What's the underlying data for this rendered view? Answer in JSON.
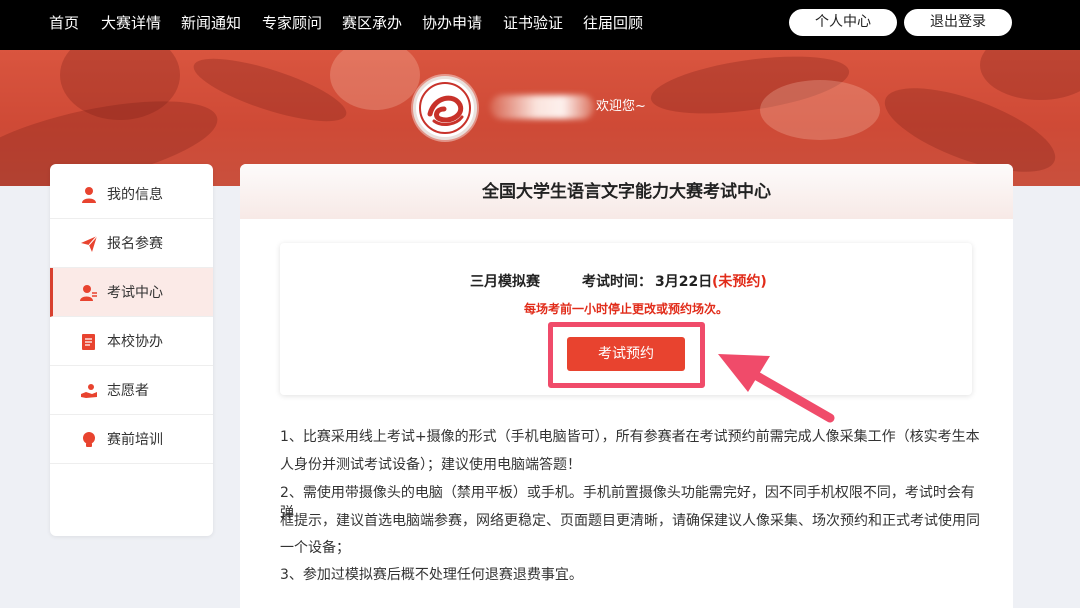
{
  "nav": {
    "links": [
      "首页",
      "大赛详情",
      "新闻通知",
      "专家顾问",
      "赛区承办",
      "协办申请",
      "证书验证",
      "往届回顾"
    ],
    "user_center": "个人中心",
    "logout": "退出登录"
  },
  "banner": {
    "welcome": "欢迎您~"
  },
  "sidebar": {
    "items": [
      {
        "label": "我的信息",
        "icon": "user-icon"
      },
      {
        "label": "报名参赛",
        "icon": "paper-plane-icon"
      },
      {
        "label": "考试中心",
        "icon": "exam-user-icon"
      },
      {
        "label": "本校协办",
        "icon": "document-icon"
      },
      {
        "label": "志愿者",
        "icon": "helping-hand-icon"
      },
      {
        "label": "赛前培训",
        "icon": "lightbulb-icon"
      }
    ],
    "active_index": 2
  },
  "main": {
    "title": "全国大学生语言文字能力大赛考试中心",
    "exam": {
      "name": "三月模拟赛",
      "time_label": "考试时间：",
      "time_value": "3月22日",
      "status": "(未预约)",
      "note": "每场考前一小时停止更改或预约场次。",
      "button": "考试预约"
    },
    "notices": [
      "1、比赛采用线上考试+摄像的形式（手机电脑皆可），所有参赛者在考试预约前需完成人像采集工作（核实考生本",
      "人身份并测试考试设备）；建议使用电脑端答题！",
      "2、需使用带摄像头的电脑（禁用平板）或手机。手机前置摄像头功能需完好，因不同手机权限不同，考试时会有弹",
      "框提示，建议首选电脑端参赛，网络更稳定、页面题目更清晰，请确保建议人像采集、场次预约和正式考试使用同",
      "一个设备；",
      "3、参加过模拟赛后概不处理任何退赛退费事宜。"
    ]
  },
  "colors": {
    "accent": "#e8432f",
    "warning_text": "#e12c1a",
    "highlight": "#f04b6a",
    "nav_bg": "#000000",
    "banner": "#cf4a36"
  }
}
